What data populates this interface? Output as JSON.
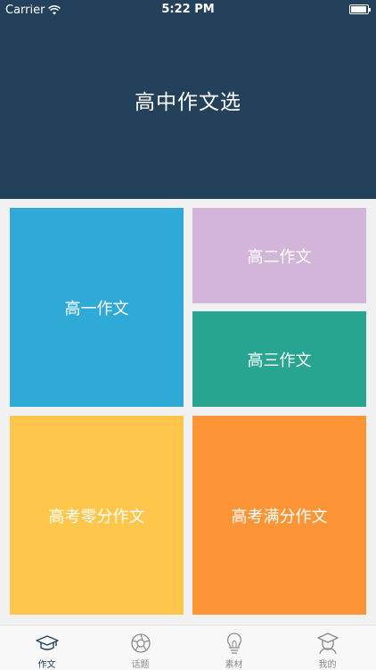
{
  "status_bar": {
    "carrier": "Carrier",
    "time": "5:22 PM"
  },
  "header": {
    "title": "高中作文选"
  },
  "tiles": [
    {
      "label": "高一作文",
      "color": "#2fa9d6"
    },
    {
      "label": "高二作文",
      "color": "#d2b5d9"
    },
    {
      "label": "高三作文",
      "color": "#27a591"
    },
    {
      "label": "高考零分作文",
      "color": "#fec64a"
    },
    {
      "label": "高考满分作文",
      "color": "#fd9537"
    }
  ],
  "tab_bar": {
    "active_color": "#23415a",
    "items": [
      {
        "label": "作文",
        "icon": "graduation-cap-icon",
        "active": true
      },
      {
        "label": "话题",
        "icon": "aperture-icon",
        "active": false
      },
      {
        "label": "素材",
        "icon": "lightbulb-icon",
        "active": false
      },
      {
        "label": "我的",
        "icon": "student-avatar-icon",
        "active": false
      }
    ]
  }
}
